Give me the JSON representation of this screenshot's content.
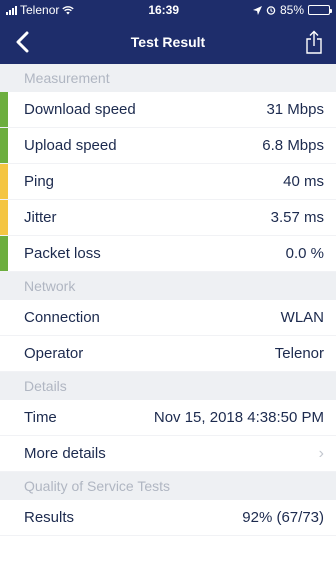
{
  "status_bar": {
    "carrier": "Telenor",
    "time": "16:39",
    "battery_percent": "85%",
    "battery_level": 0.85
  },
  "nav": {
    "title": "Test Result",
    "back_icon": "chevron-left-icon",
    "share_icon": "share-icon"
  },
  "colors": {
    "nav_background": "#1e2d6b",
    "good": "#6cae3e",
    "medium": "#f4c542"
  },
  "sections": {
    "measurement": {
      "title": "Measurement",
      "rows": [
        {
          "label": "Download speed",
          "value": "31 Mbps",
          "status": "good"
        },
        {
          "label": "Upload speed",
          "value": "6.8 Mbps",
          "status": "good"
        },
        {
          "label": "Ping",
          "value": "40 ms",
          "status": "medium"
        },
        {
          "label": "Jitter",
          "value": "3.57 ms",
          "status": "medium"
        },
        {
          "label": "Packet loss",
          "value": "0.0 %",
          "status": "good"
        }
      ]
    },
    "network": {
      "title": "Network",
      "rows": [
        {
          "label": "Connection",
          "value": "WLAN"
        },
        {
          "label": "Operator",
          "value": "Telenor"
        }
      ]
    },
    "details": {
      "title": "Details",
      "rows": [
        {
          "label": "Time",
          "value": "Nov 15, 2018 4:38:50 PM"
        },
        {
          "label": "More details",
          "value": "›"
        }
      ]
    },
    "qos": {
      "title": "Quality of Service Tests",
      "rows": [
        {
          "label": "Results",
          "value": "92% (67/73)"
        }
      ]
    }
  }
}
